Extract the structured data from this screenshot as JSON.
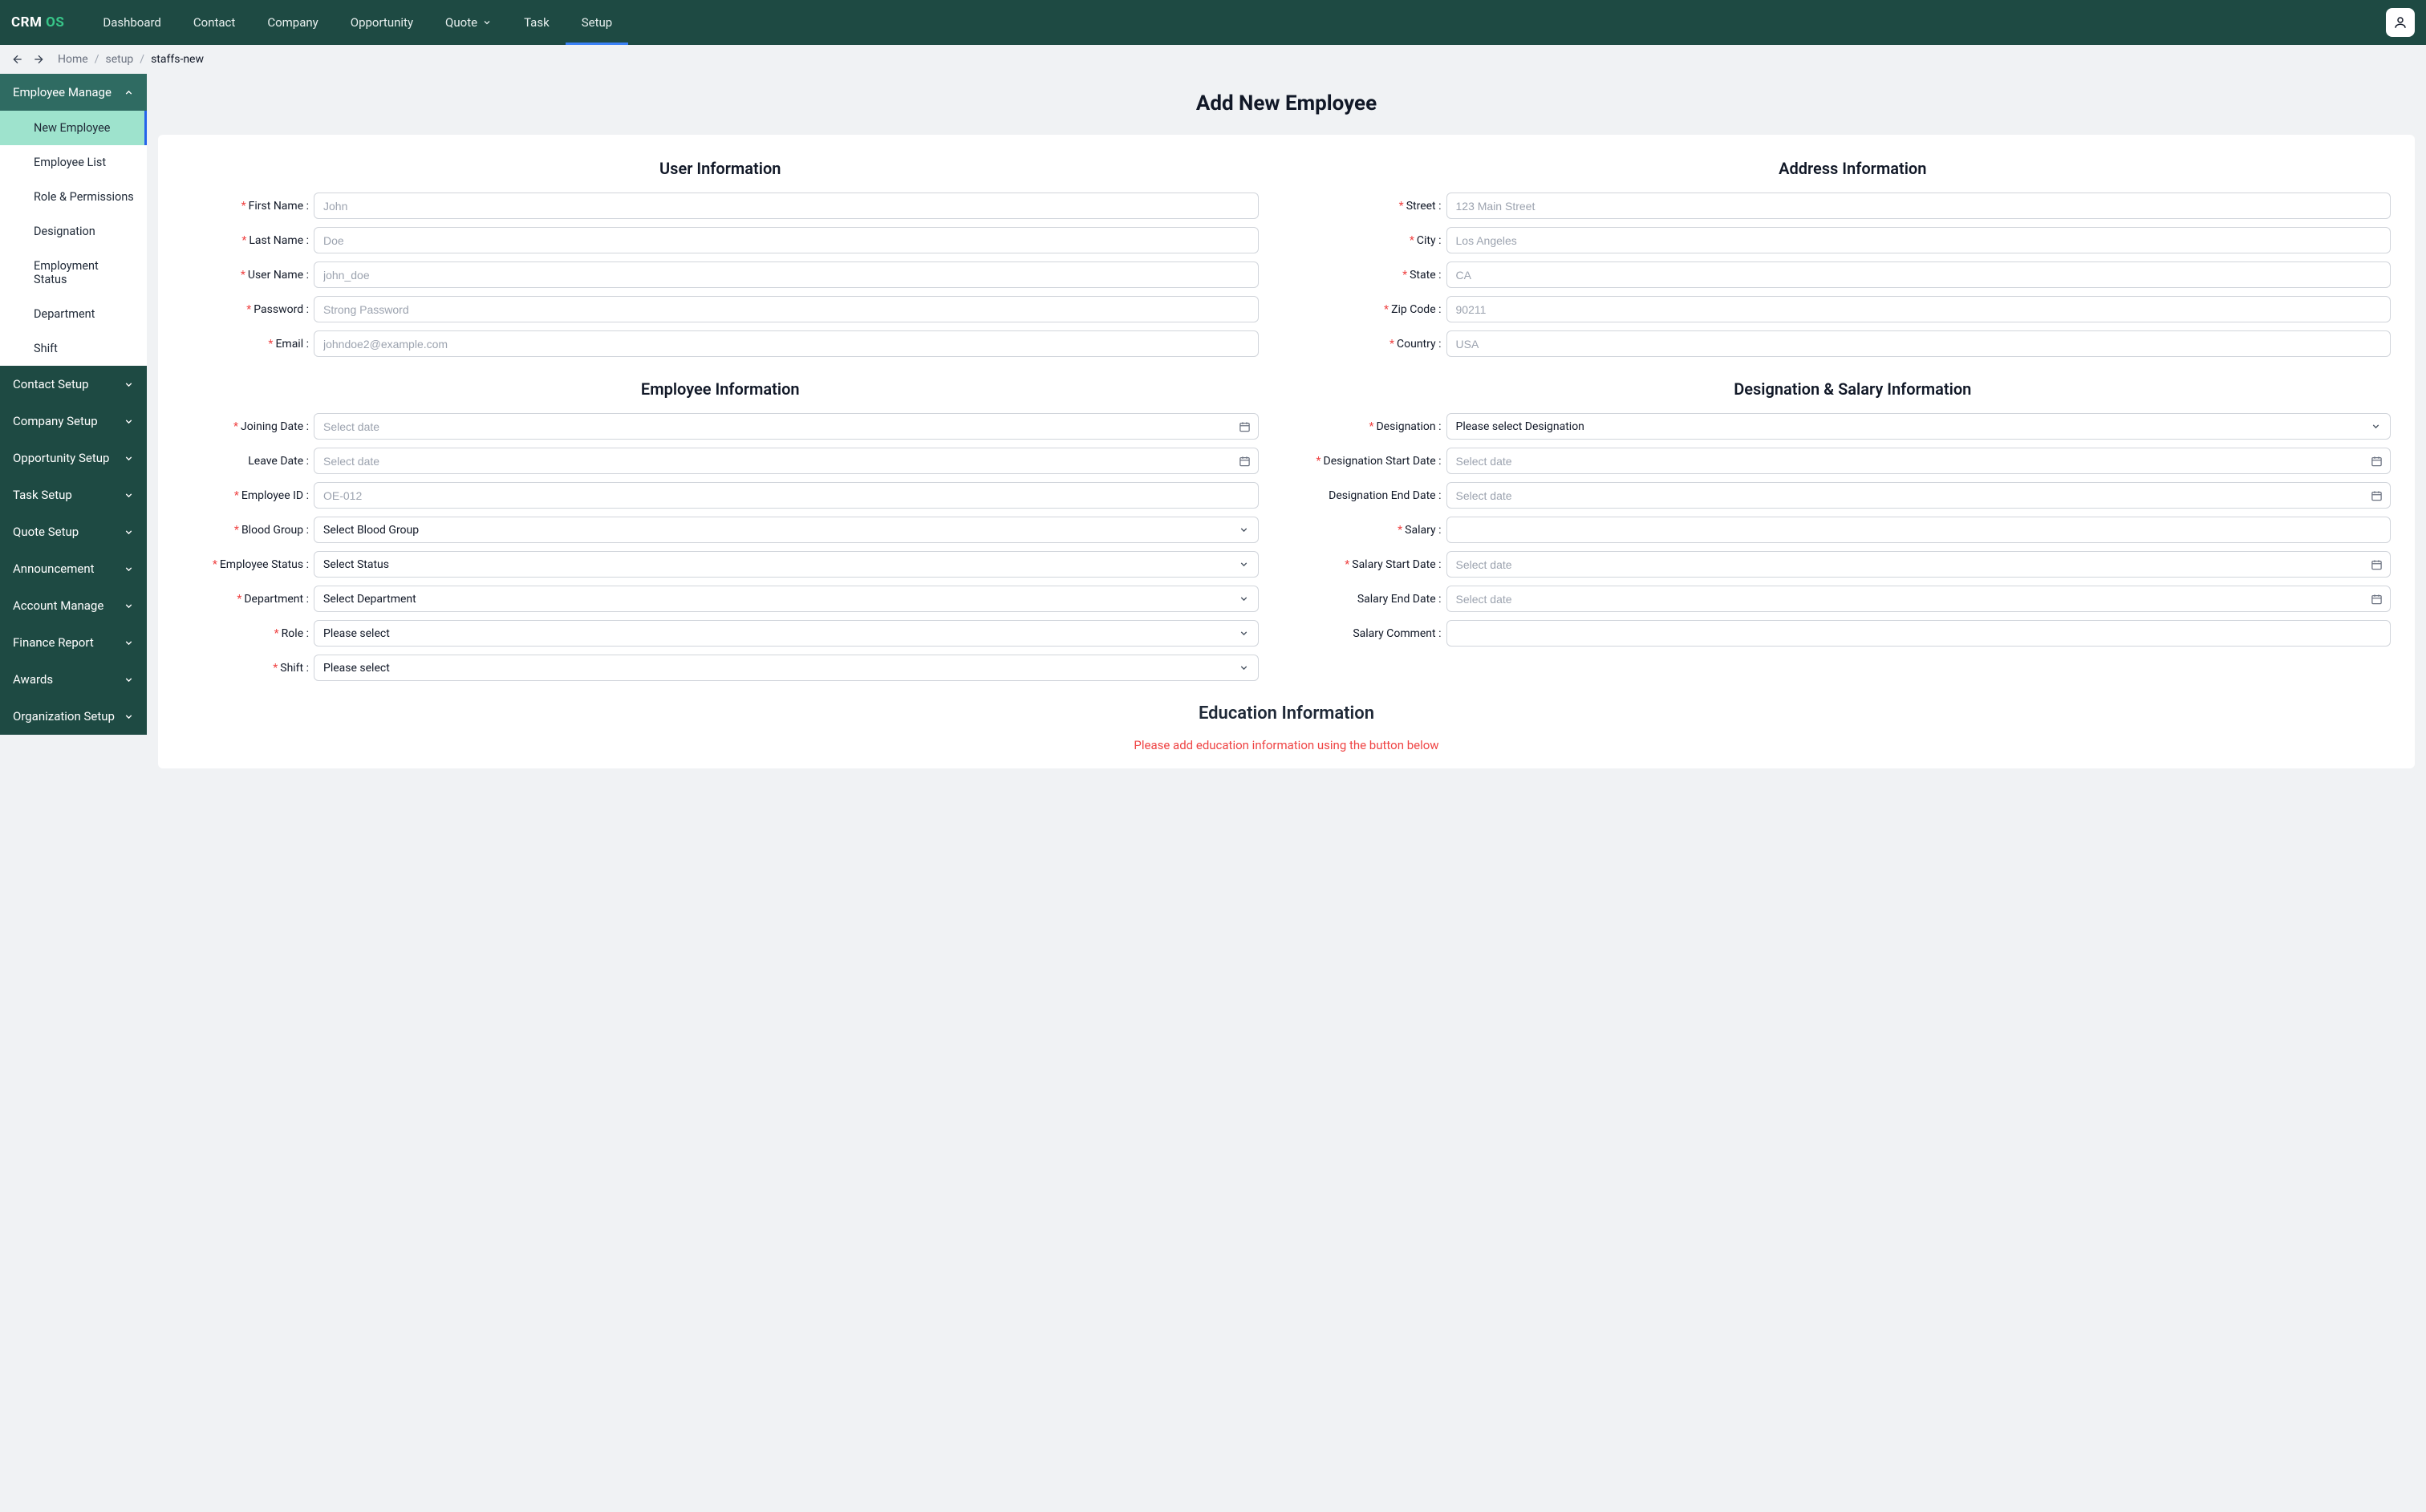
{
  "brand": {
    "a": "CRM",
    "b": "OS"
  },
  "nav": [
    {
      "label": "Dashboard"
    },
    {
      "label": "Contact"
    },
    {
      "label": "Company"
    },
    {
      "label": "Opportunity"
    },
    {
      "label": "Quote",
      "caret": true
    },
    {
      "label": "Task"
    },
    {
      "label": "Setup",
      "active": true
    }
  ],
  "breadcrumbs": {
    "home": "Home",
    "setup": "setup",
    "current": "staffs-new"
  },
  "sidebar": {
    "employee_manage": {
      "label": "Employee Manage",
      "items": [
        "New Employee",
        "Employee List",
        "Role & Permissions",
        "Designation",
        "Employment Status",
        "Department",
        "Shift"
      ]
    },
    "sections": [
      "Contact Setup",
      "Company Setup",
      "Opportunity Setup",
      "Task Setup",
      "Quote Setup",
      "Announcement",
      "Account Manage",
      "Finance Report",
      "Awards",
      "Organization Setup"
    ]
  },
  "page_title": "Add New Employee",
  "sections": {
    "user": "User Information",
    "address": "Address Information",
    "employee": "Employee Information",
    "designation": "Designation & Salary Information",
    "education_title": "Education Information",
    "education_note": "Please add education information using the button below"
  },
  "labels": {
    "first_name": "First Name",
    "last_name": "Last Name",
    "user_name": "User Name",
    "password": "Password",
    "email": "Email",
    "street": "Street",
    "city": "City",
    "state": "State",
    "zip": "Zip Code",
    "country": "Country",
    "joining_date": "Joining Date",
    "leave_date": "Leave Date",
    "employee_id": "Employee ID",
    "blood_group": "Blood Group",
    "employee_status": "Employee Status",
    "department": "Department",
    "role": "Role",
    "shift": "Shift",
    "designation": "Designation",
    "designation_start": "Designation Start Date",
    "designation_end": "Designation End Date",
    "salary": "Salary",
    "salary_start": "Salary Start Date",
    "salary_end": "Salary End Date",
    "salary_comment": "Salary Comment"
  },
  "placeholders": {
    "first_name": "John",
    "last_name": "Doe",
    "user_name": "john_doe",
    "password": "Strong Password",
    "email": "johndoe2@example.com",
    "street": "123 Main Street",
    "city": "Los Angeles",
    "state": "CA",
    "zip": "90211",
    "country": "USA",
    "select_date": "Select date",
    "employee_id": "OE-012",
    "blood_group": "Select Blood Group",
    "select_status": "Select Status",
    "select_department": "Select Department",
    "please_select": "Please select",
    "please_select_designation": "Please select Designation"
  }
}
